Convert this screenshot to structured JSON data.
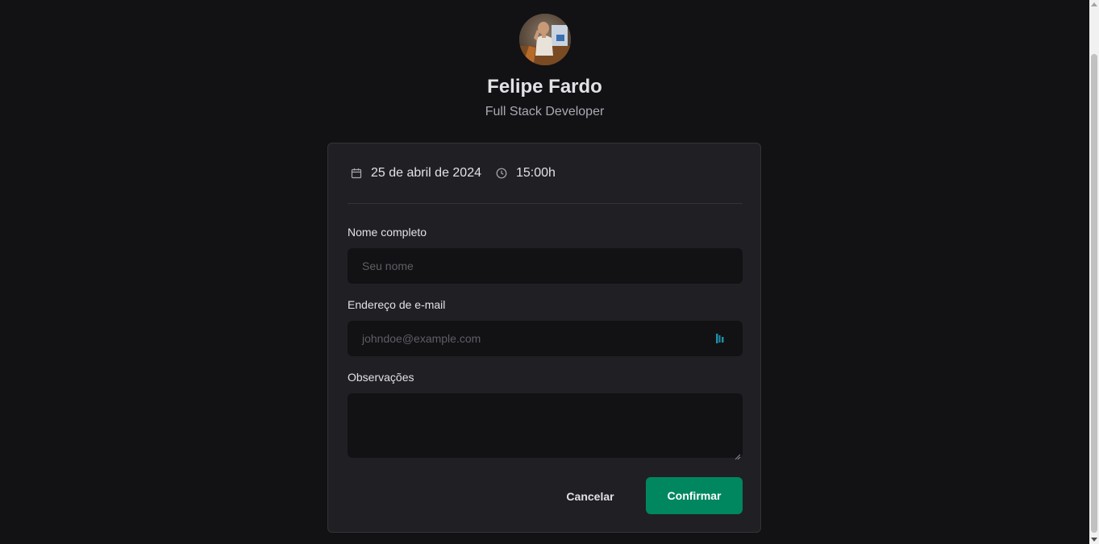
{
  "profile": {
    "name": "Felipe Fardo",
    "role": "Full Stack Developer"
  },
  "schedule": {
    "date": "25 de abril de 2024",
    "time": "15:00h",
    "date_icon": "calendar-icon",
    "time_icon": "clock-icon"
  },
  "form": {
    "name_label": "Nome completo",
    "name_placeholder": "Seu nome",
    "name_value": "",
    "email_label": "Endereço de e-mail",
    "email_placeholder": "johndoe@example.com",
    "email_value": "",
    "notes_label": "Observações",
    "notes_value": ""
  },
  "actions": {
    "cancel_label": "Cancelar",
    "confirm_label": "Confirmar"
  },
  "colors": {
    "background": "#121214",
    "card": "#202024",
    "accent": "#00875f",
    "text": "#e1e1e6",
    "muted": "#a9a9b2"
  }
}
